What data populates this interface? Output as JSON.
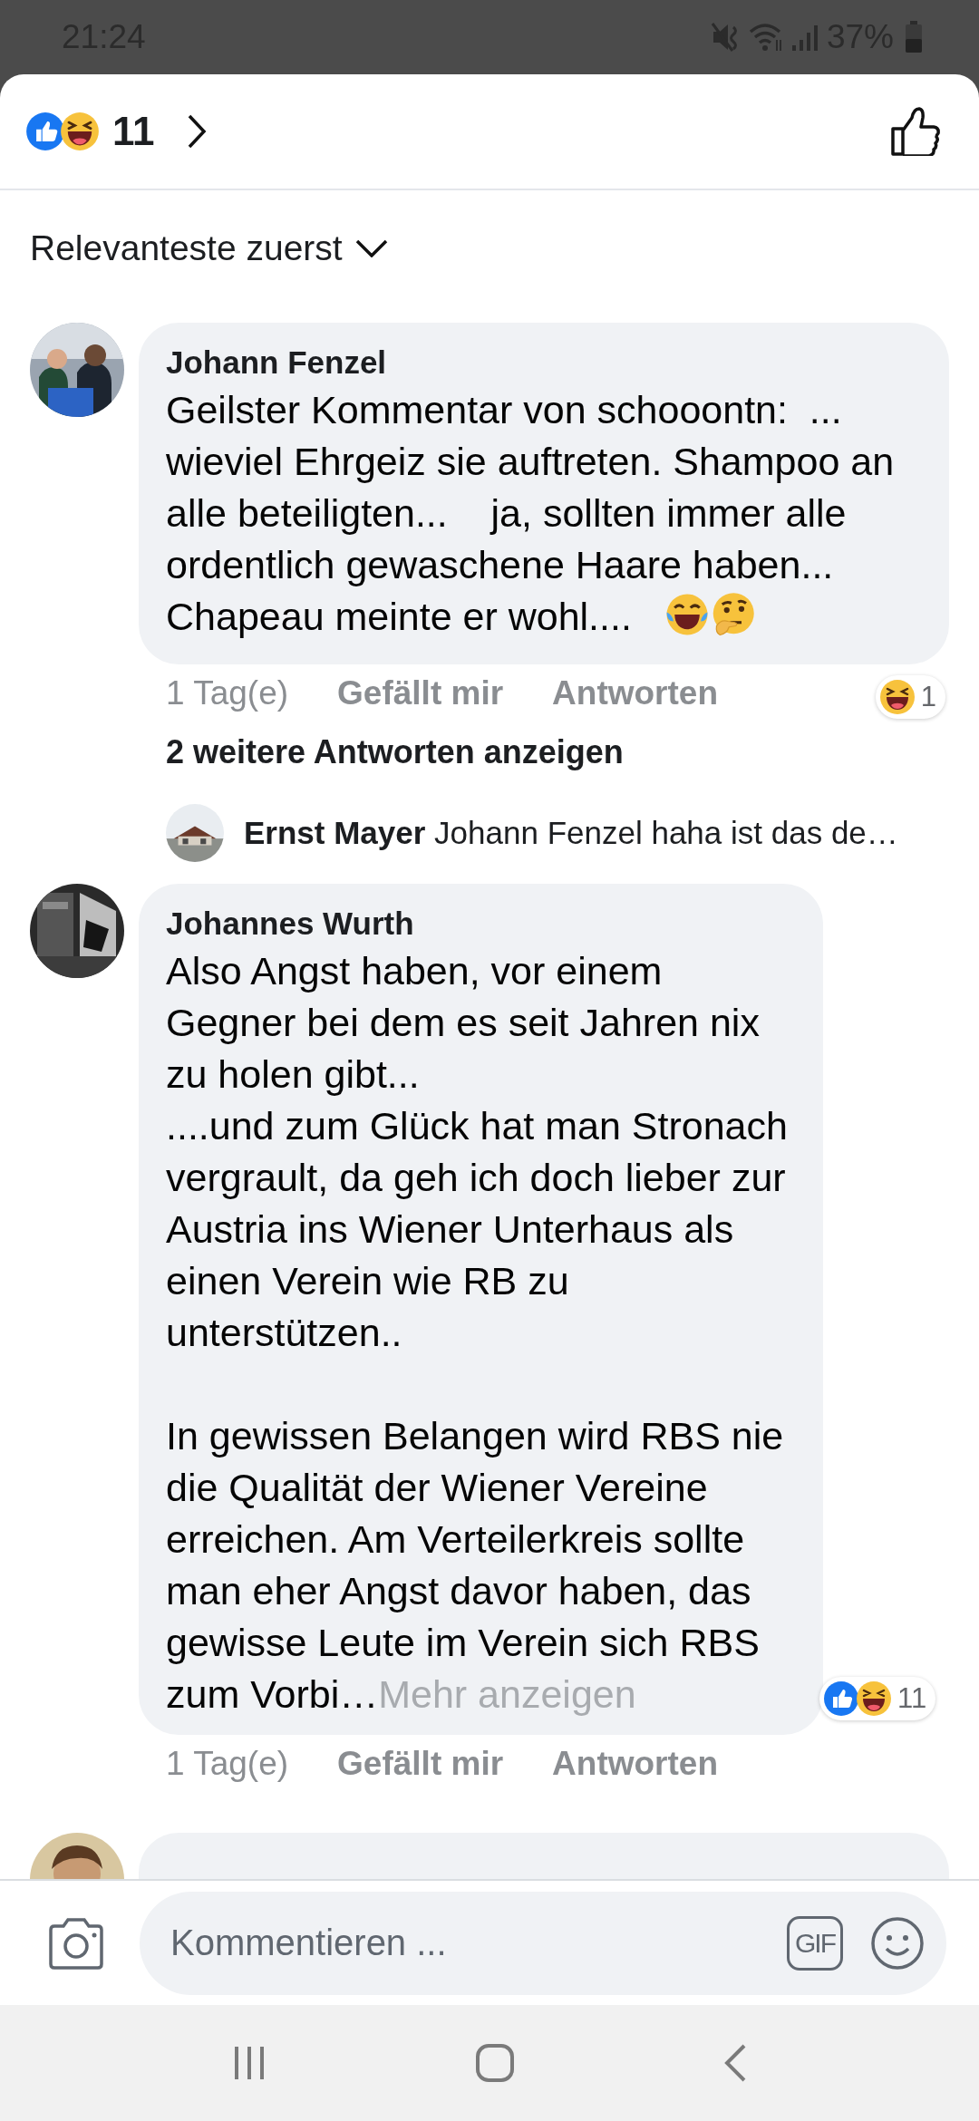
{
  "status_bar": {
    "time": "21:24",
    "battery": "37%"
  },
  "header": {
    "reactions": [
      {
        "kind": "like"
      },
      {
        "kind": "haha"
      }
    ],
    "count": "11"
  },
  "sort": {
    "label": "Relevanteste zuerst"
  },
  "comments": [
    {
      "author": "Johann Fenzel",
      "text": "Geilster Kommentar von schooontn:  ...\nwieviel Ehrgeiz sie auftreten. Shampoo an alle beteiligten...    ja, sollten immer alle ordentlich gewaschene Haare haben...\nChapeau meinte er wohl....   ",
      "text_emoji": [
        {
          "kind": "joy"
        },
        {
          "kind": "thinking"
        }
      ],
      "reactions": [
        {
          "kind": "haha"
        }
      ],
      "reaction_count": "1",
      "time": "1 Tag(e)",
      "like_label": "Gefällt mir",
      "reply_label": "Antworten",
      "more_replies": "2 weitere Antworten anzeigen",
      "reply_preview": "**Ernst Mayer** Johann Fenzel haha ist das de…"
    },
    {
      "author": "Johannes Wurth",
      "text": "Also Angst haben, vor einem Gegner bei dem es seit Jahren nix zu holen gibt...\n....und zum Glück hat man Stronach vergrault, da geh ich doch lieber zur Austria ins Wiener Unterhaus als einen Verein wie RB zu unterstützen..\n\nIn gewissen Belangen wird RBS nie die Qualität der Wiener Vereine erreichen. Am Verteilerkreis sollte man eher Angst davor haben, das gewisse Leute im Verein sich RBS zum Vorbi…",
      "more_label": "Mehr anzeigen",
      "reactions": [
        {
          "kind": "like"
        },
        {
          "kind": "haha"
        }
      ],
      "reaction_count": "11",
      "time": "1 Tag(e)",
      "like_label": "Gefällt mir",
      "reply_label": "Antworten"
    }
  ],
  "more_below": true,
  "composer": {
    "placeholder": "Kommentieren ...",
    "gif_label": "GIF"
  }
}
